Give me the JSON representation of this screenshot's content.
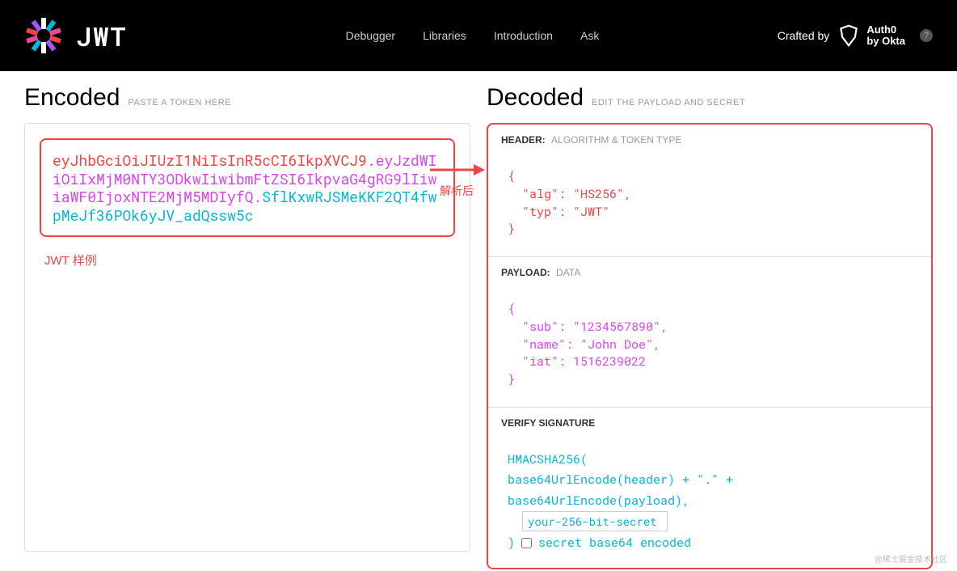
{
  "header": {
    "brand": "JWT",
    "nav": [
      "Debugger",
      "Libraries",
      "Introduction",
      "Ask"
    ],
    "crafted_by": "Crafted by",
    "auth0_line1": "Auth0",
    "auth0_line2": "by Okta"
  },
  "encoded": {
    "title": "Encoded",
    "subtitle": "PASTE A TOKEN HERE",
    "token_header": "eyJhbGciOiJIUzI1NiIsInR5cCI6IkpXVCJ9",
    "token_payload": "eyJzdWIiOiIxMjM0NTY3ODkwIiwibmFtZSI6IkpvaG4gRG9lIiwiaWF0IjoxNTE2MjM5MDIyfQ",
    "token_signature": "SflKxwRJSMeKKF2QT4fwpMeJf36POk6yJV_adQssw5c",
    "sample_label": "JWT 样例"
  },
  "arrow": {
    "label": "解析后"
  },
  "decoded": {
    "title": "Decoded",
    "subtitle": "EDIT THE PAYLOAD AND SECRET",
    "header_section": {
      "label": "HEADER:",
      "desc": "ALGORITHM & TOKEN TYPE",
      "code": "{\n  \"alg\": \"HS256\",\n  \"typ\": \"JWT\"\n}"
    },
    "payload_section": {
      "label": "PAYLOAD:",
      "desc": "DATA",
      "code": "{\n  \"sub\": \"1234567890\",\n  \"name\": \"John Doe\",\n  \"iat\": 1516239022\n}"
    },
    "signature_section": {
      "label": "VERIFY SIGNATURE",
      "line1": "HMACSHA256(",
      "line2": "  base64UrlEncode(header) + \".\" +",
      "line3": "  base64UrlEncode(payload),",
      "secret_value": "your-256-bit-secret",
      "line4_close": ")",
      "checkbox_label": "secret base64 encoded"
    }
  },
  "watermark": "@稀土掘金技术社区"
}
